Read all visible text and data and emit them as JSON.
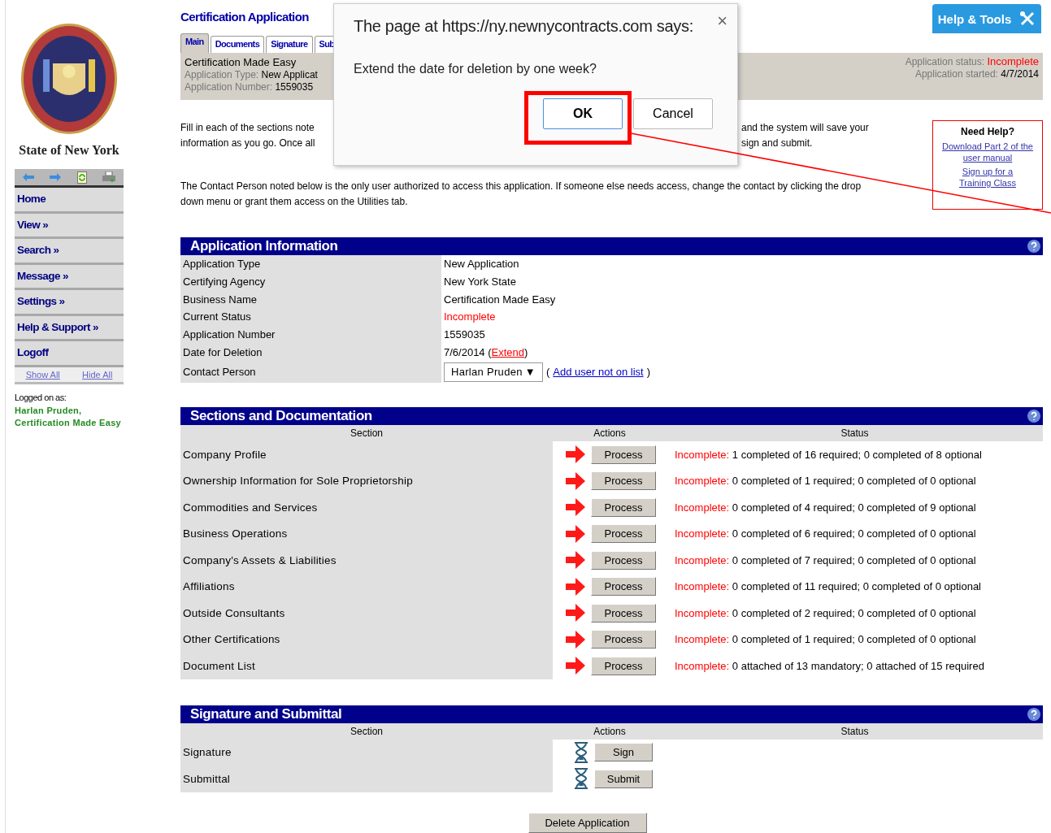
{
  "sidebar": {
    "caption": "State of New York",
    "nav": [
      {
        "label": "Home"
      },
      {
        "label": "View »"
      },
      {
        "label": "Search »"
      },
      {
        "label": "Message »"
      },
      {
        "label": "Settings »"
      },
      {
        "label": "Help & Support »"
      },
      {
        "label": "Logoff"
      }
    ],
    "show_all": "Show All",
    "hide_all": "Hide All",
    "logged_on_label": "Logged on as:",
    "logged_on_user": "Harlan Pruden, Certification Made Easy"
  },
  "header": {
    "title": "Certification Application",
    "help_tools": "Help & Tools",
    "tabs": [
      {
        "label": "Main",
        "selected": true
      },
      {
        "label": "Documents",
        "selected": false
      },
      {
        "label": "Signature",
        "selected": false
      },
      {
        "label": "Sub",
        "selected": false
      }
    ],
    "business": "Certification Made Easy",
    "type_label": "Application Type:",
    "type_value": "New Applicat",
    "number_label": "Application Number:",
    "number_value": "1559035",
    "status_label": "Application status:",
    "status_value": "Incomplete",
    "started_label": "Application started:",
    "started_value": "4/7/2014"
  },
  "intro": {
    "left_lines": [
      "Fill in each of the sections note",
      "information as you go. Once all"
    ],
    "right_lines": [
      "and the system will save your",
      "sign and submit."
    ],
    "contact_note": "The Contact Person noted below is the only user authorized to access this application. If someone else needs access, change the contact by clicking the drop down menu or grant them access on the Utilities tab."
  },
  "help_box": {
    "title": "Need Help?",
    "links": [
      "Download Part 2 of the user manual",
      "Sign up for a Training Class"
    ]
  },
  "application_information": {
    "title": "Application Information",
    "rows": [
      {
        "kind": "text",
        "label": "Application Type",
        "value": "New Application"
      },
      {
        "kind": "text",
        "label": "Certifying Agency",
        "value": "New York State"
      },
      {
        "kind": "text",
        "label": "Business Name",
        "value": "Certification Made Easy"
      },
      {
        "kind": "status",
        "label": "Current Status",
        "value": "Incomplete"
      },
      {
        "kind": "text",
        "label": "Application Number",
        "value": "1559035"
      },
      {
        "kind": "date",
        "label": "Date for Deletion",
        "value": "7/6/2014",
        "open": "(",
        "link": "Extend",
        "close": ")"
      },
      {
        "kind": "select",
        "label": "Contact Person",
        "value": "Harlan Pruden",
        "arrow": "▼",
        "open": "(",
        "link": "Add user not on list",
        "close": ")"
      }
    ]
  },
  "sections": {
    "title": "Sections and Documentation",
    "columns": [
      "Section",
      "Actions",
      "Status"
    ],
    "rows": [
      {
        "name": "Company Profile",
        "action": "Process",
        "status_label": "Incomplete:",
        "status_text": "1 completed of 16 required; 0 completed of 8 optional"
      },
      {
        "name": "Ownership Information for Sole Proprietorship",
        "action": "Process",
        "status_label": "Incomplete:",
        "status_text": "0 completed of 1 required; 0 completed of 0 optional"
      },
      {
        "name": "Commodities and Services",
        "action": "Process",
        "status_label": "Incomplete:",
        "status_text": "0 completed of 4 required; 0 completed of 9 optional"
      },
      {
        "name": "Business Operations",
        "action": "Process",
        "status_label": "Incomplete:",
        "status_text": "0 completed of 6 required; 0 completed of 0 optional"
      },
      {
        "name": "Company's Assets & Liabilities",
        "action": "Process",
        "status_label": "Incomplete:",
        "status_text": "0 completed of 7 required; 0 completed of 0 optional"
      },
      {
        "name": "Affiliations",
        "action": "Process",
        "status_label": "Incomplete:",
        "status_text": "0 completed of 11 required; 0 completed of 0 optional"
      },
      {
        "name": "Outside Consultants",
        "action": "Process",
        "status_label": "Incomplete:",
        "status_text": "0 completed of 2 required; 0 completed of 0 optional"
      },
      {
        "name": "Other Certifications",
        "action": "Process",
        "status_label": "Incomplete:",
        "status_text": "0 completed of 1 required; 0 completed of 0 optional"
      },
      {
        "name": "Document List",
        "action": "Process",
        "status_label": "Incomplete:",
        "status_text": "0 attached of 13 mandatory; 0 attached of 15 required"
      }
    ]
  },
  "signature": {
    "title": "Signature and Submittal",
    "columns": [
      "Section",
      "Actions",
      "Status"
    ],
    "rows": [
      {
        "name": "Signature",
        "action": "Sign"
      },
      {
        "name": "Submittal",
        "action": "Submit"
      }
    ]
  },
  "delete_button": "Delete Application",
  "dialog": {
    "heading": "The page at https://ny.newnycontracts.com says:",
    "close": "×",
    "message": "Extend the date for deletion by one week?",
    "buttons": [
      {
        "label": "OK",
        "selected": true,
        "highlighted": true
      },
      {
        "label": "Cancel",
        "selected": false,
        "highlighted": false
      }
    ]
  }
}
